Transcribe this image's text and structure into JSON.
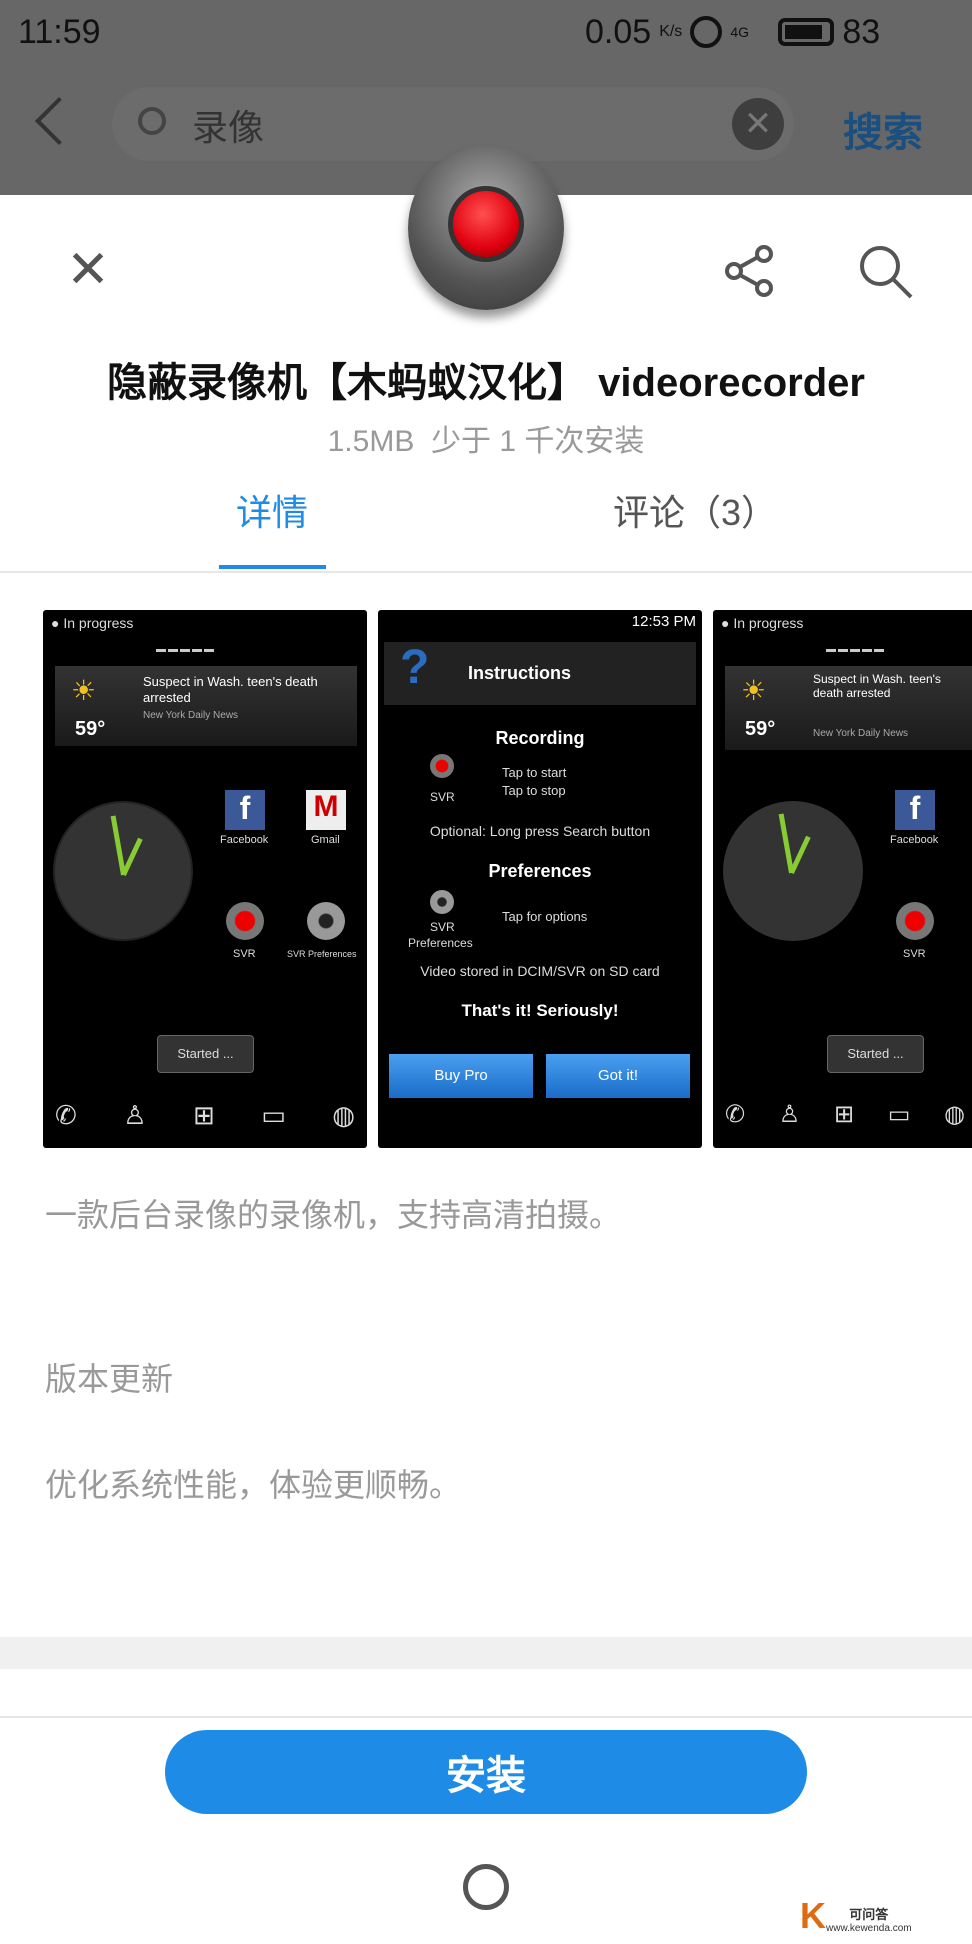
{
  "status_bar": {
    "time": "11:59",
    "net_speed": "0.05",
    "net_unit": "K/s",
    "network": "4G",
    "battery": "83"
  },
  "search": {
    "query": "录像",
    "submit": "搜索"
  },
  "app": {
    "name": "隐蔽录像机【木蚂蚁汉化】 videorecorder",
    "size": "1.5MB",
    "installs": "少于 1 千次安装"
  },
  "tabs": [
    {
      "label": "详情",
      "active": true
    },
    {
      "label": "评论（3）",
      "active": false
    }
  ],
  "screens": {
    "home": {
      "status": "In progress",
      "news": "Suspect in Wash. teen's death arrested",
      "source": "New York Daily News",
      "temp": "59°",
      "apps": [
        "Facebook",
        "Gmail",
        "SVR",
        "SVR Preferences"
      ],
      "button": "Started ..."
    },
    "instructions": {
      "time": "12:53 PM",
      "header": "Instructions",
      "recording": "Recording",
      "svr": "SVR",
      "tap_start": "Tap to start",
      "tap_stop": "Tap to stop",
      "optional": "Optional: Long press Search button",
      "preferences": "Preferences",
      "svr_pref": "SVR",
      "svr_pref2": "Preferences",
      "tap_options": "Tap for options",
      "stored": "Video stored in DCIM/SVR on SD card",
      "seriously": "That's it! Seriously!",
      "buy": "Buy Pro",
      "got": "Got it!"
    }
  },
  "description": "一款后台录像的录像机，支持高清拍摄。",
  "update_heading": "版本更新",
  "update_text": "优化系统性能，体验更顺畅。",
  "install_label": "安装",
  "watermark": {
    "text": "可问答",
    "url": "www.kewenda.com"
  },
  "colors": {
    "accent": "#1e8ce6",
    "overlay": "#676767"
  }
}
